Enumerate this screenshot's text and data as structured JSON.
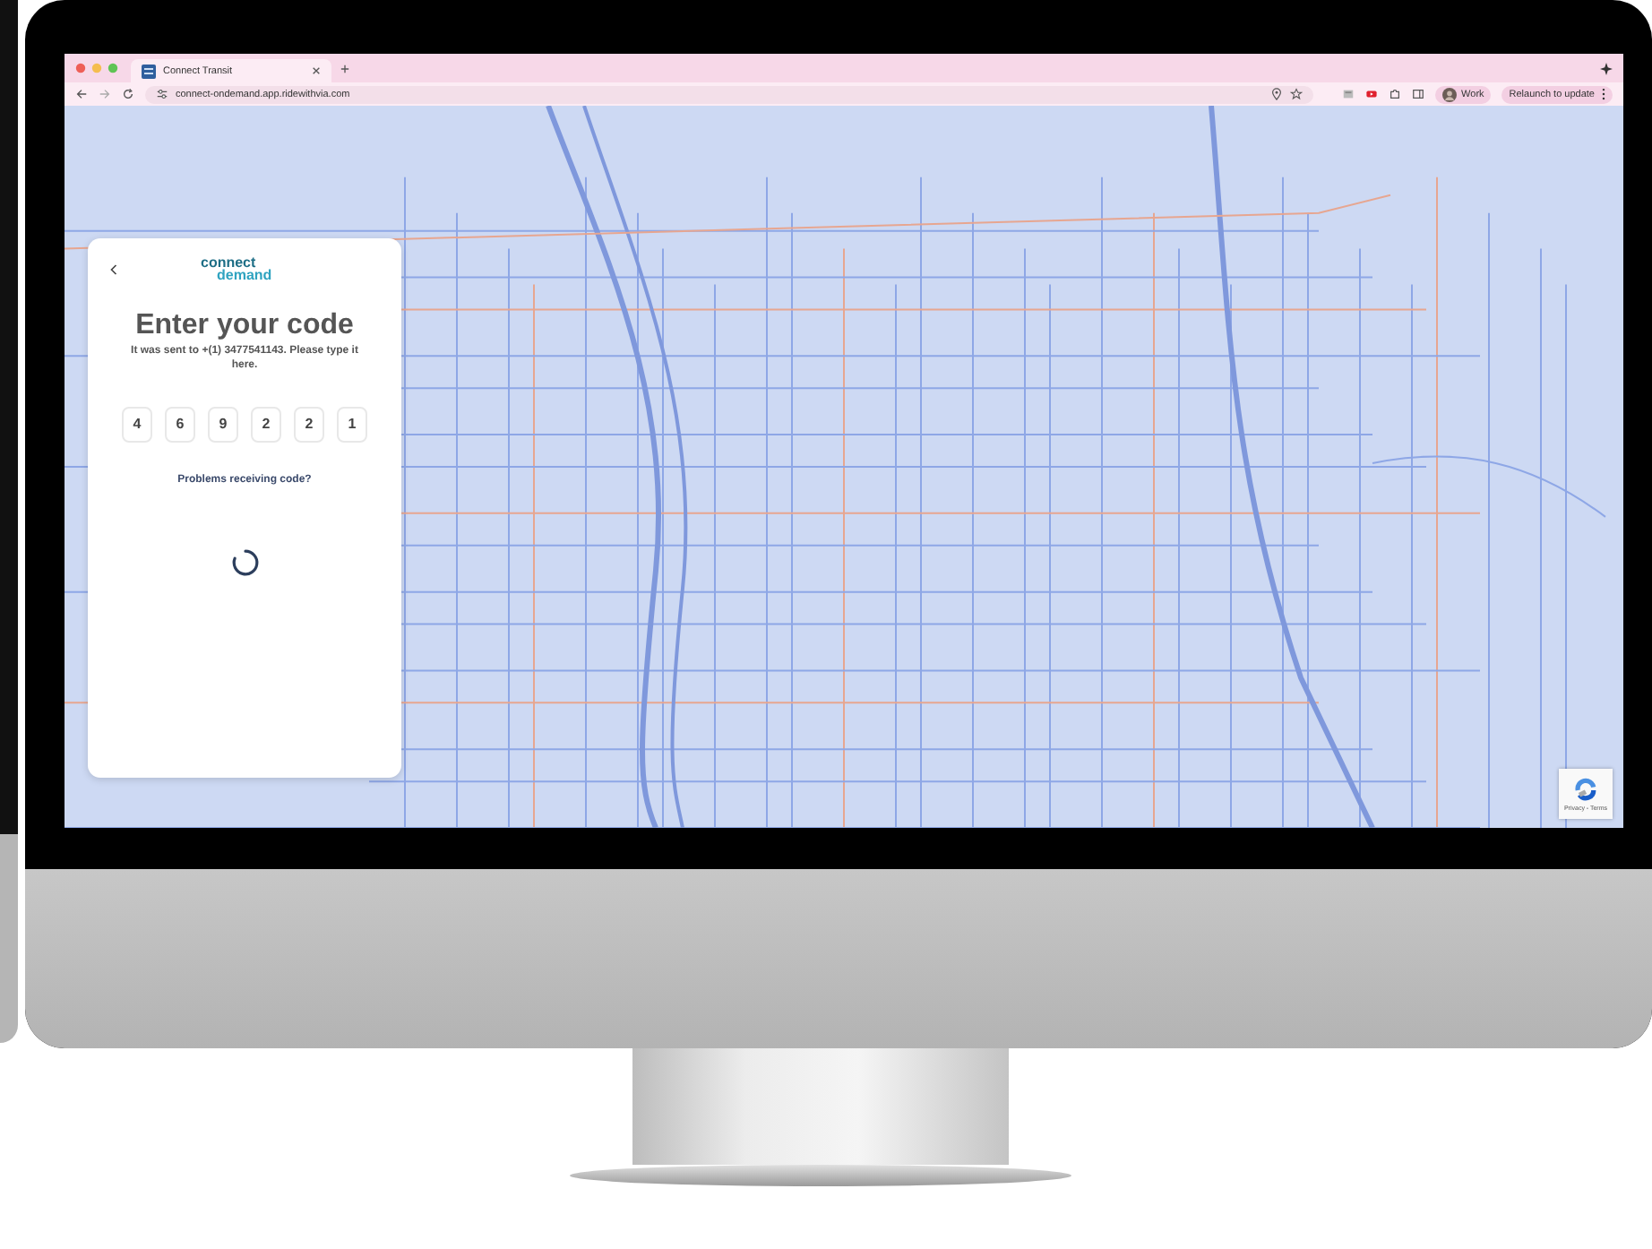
{
  "browser": {
    "tabs": [
      {
        "title": "Connect Transit",
        "selected": true
      }
    ],
    "address": "connect-ondemand.app.ridewithvia.com",
    "profile": "Work",
    "relaunch": "Relaunch to update"
  },
  "login_card": {
    "logo": {
      "line1": "connect",
      "line2": "demand"
    },
    "title": "Enter your code",
    "message": "It was sent to +(1) 3477541143. Please type it here.",
    "code_digits": [
      "4",
      "6",
      "9",
      "2",
      "2",
      "1"
    ],
    "help_link": "Problems receiving code?",
    "loading": true
  },
  "recaptcha": {
    "links": "Privacy - Terms"
  }
}
